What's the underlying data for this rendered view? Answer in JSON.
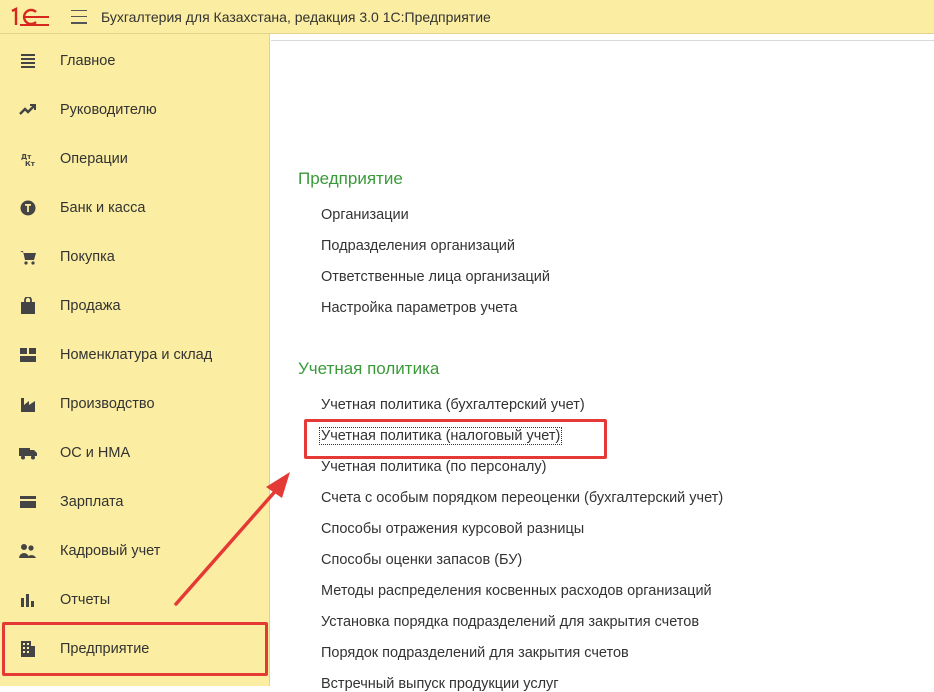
{
  "window": {
    "title": "Бухгалтерия для Казахстана, редакция 3.0 1С:Предприятие",
    "logo_text": "1С",
    "brand_color": "#d7261e",
    "titlebar_color": "#fbeda1"
  },
  "sidebar": {
    "items": [
      {
        "label": "Главное",
        "icon": "menu-lines-icon"
      },
      {
        "label": "Руководителю",
        "icon": "trend-chart-icon"
      },
      {
        "label": "Операции",
        "icon": "debit-credit-icon"
      },
      {
        "label": "Банк и касса",
        "icon": "coin-icon"
      },
      {
        "label": "Покупка",
        "icon": "cart-icon"
      },
      {
        "label": "Продажа",
        "icon": "shopping-bag-icon"
      },
      {
        "label": "Номенклатура и склад",
        "icon": "warehouse-icon"
      },
      {
        "label": "Производство",
        "icon": "factory-icon"
      },
      {
        "label": "ОС и НМА",
        "icon": "truck-icon"
      },
      {
        "label": "Зарплата",
        "icon": "wallet-icon"
      },
      {
        "label": "Кадровый учет",
        "icon": "people-icon"
      },
      {
        "label": "Отчеты",
        "icon": "bar-chart-icon"
      },
      {
        "label": "Предприятие",
        "icon": "building-icon"
      }
    ],
    "highlighted_item": "Предприятие"
  },
  "main": {
    "sections": [
      {
        "title": "Предприятие",
        "links": [
          "Организации",
          "Подразделения организаций",
          "Ответственные лица организаций",
          "Настройка параметров учета"
        ]
      },
      {
        "title": "Учетная политика",
        "links": [
          "Учетная политика (бухгалтерский учет)",
          "Учетная политика (налоговый учет)",
          "Учетная политика (по персоналу)",
          "Счета с особым порядком переоценки (бухгалтерский учет)",
          "Способы отражения курсовой разницы",
          "Способы оценки запасов (БУ)",
          "Методы распределения косвенных расходов организаций",
          "Установка порядка подразделений для закрытия счетов",
          "Порядок подразделений для закрытия счетов",
          "Встречный выпуск продукции услуг"
        ]
      }
    ],
    "highlighted_link": "Учетная политика (налоговый учет)"
  },
  "colors": {
    "section_title": "#3a9a3a",
    "annotation_red": "#e53935"
  }
}
